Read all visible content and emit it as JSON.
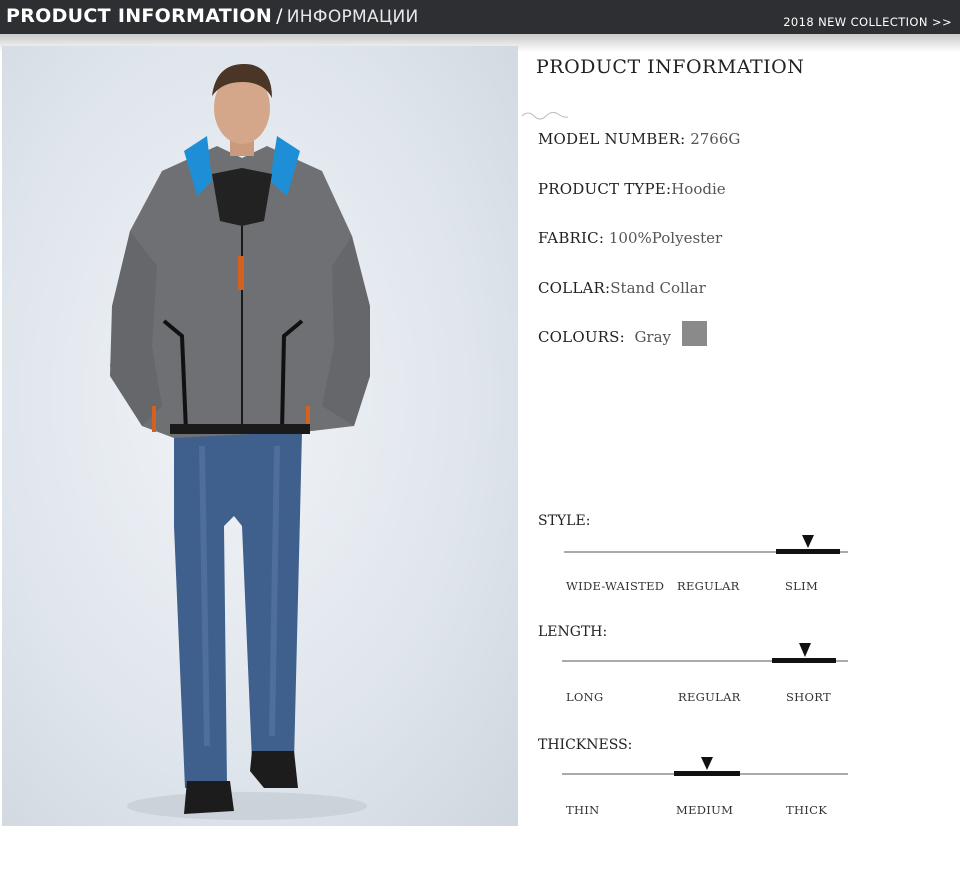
{
  "header": {
    "title": "PRODUCT INFORMATION",
    "separator": "/",
    "title_ru": "ИНФОРМАЦИИ",
    "collection_link": "2018 NEW COLLECTION >>"
  },
  "panel": {
    "title": "PRODUCT INFORMATION",
    "specs": [
      {
        "label": "MODEL NUMBER:",
        "value": " 2766G"
      },
      {
        "label": "PRODUCT TYPE:",
        "value": "Hoodie"
      },
      {
        "label": "FABRIC:",
        "value": " 100%Polyester"
      },
      {
        "label": "COLLAR:",
        "value": "Stand Collar"
      },
      {
        "label": "COLOURS:",
        "value": "  Gray"
      }
    ],
    "swatch_color": "#8a8a8a"
  },
  "scales": [
    {
      "label": "STYLE:",
      "options": [
        "WIDE-WAISTED",
        "REGULAR",
        "SLIM"
      ],
      "selected": "SLIM"
    },
    {
      "label": "LENGTH:",
      "options": [
        "LONG",
        "REGULAR",
        "SHORT"
      ],
      "selected": "SHORT"
    },
    {
      "label": "THICKNESS:",
      "options": [
        "THIN",
        "MEDIUM",
        "THICK"
      ],
      "selected": "MEDIUM"
    }
  ],
  "photo": {
    "subject": "model-wearing-gray-hoodie",
    "colors": {
      "hoodie": "#6e7074",
      "lining": "#1e8fd6",
      "jeans": "#3f5f8c",
      "boots": "#1c1c1c",
      "zip_pull": "#d2621e"
    }
  }
}
